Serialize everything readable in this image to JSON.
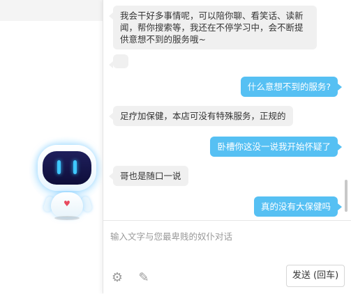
{
  "messages": [
    {
      "role": "bot",
      "text": "我会干好多事情呢，可以陪你聊、看笑话、读新闻，帮你搜索等，我还在不停学习中，会不断提供意想不到的服务哦~"
    },
    {
      "role": "bot",
      "text": ""
    },
    {
      "role": "user",
      "text": "什么意想不到的服务?"
    },
    {
      "role": "bot",
      "text": "足疗加保健，本店可没有特殊服务，正规的"
    },
    {
      "role": "user",
      "text": "卧槽你这没一说我开始怀疑了"
    },
    {
      "role": "bot",
      "text": "哥也是随口一说"
    },
    {
      "role": "user",
      "text": "真的没有大保健吗"
    }
  ],
  "input": {
    "placeholder": "输入文字与您最卑贱的奴仆对话"
  },
  "toolbar": {
    "send_label": "发送 (回车)",
    "settings_icon": "gear-icon",
    "edit_icon": "edit-icon"
  },
  "colors": {
    "user_bubble": "#56c0f3",
    "bot_bubble": "#f0f0f0",
    "robot_eye": "#3fc8ff"
  }
}
